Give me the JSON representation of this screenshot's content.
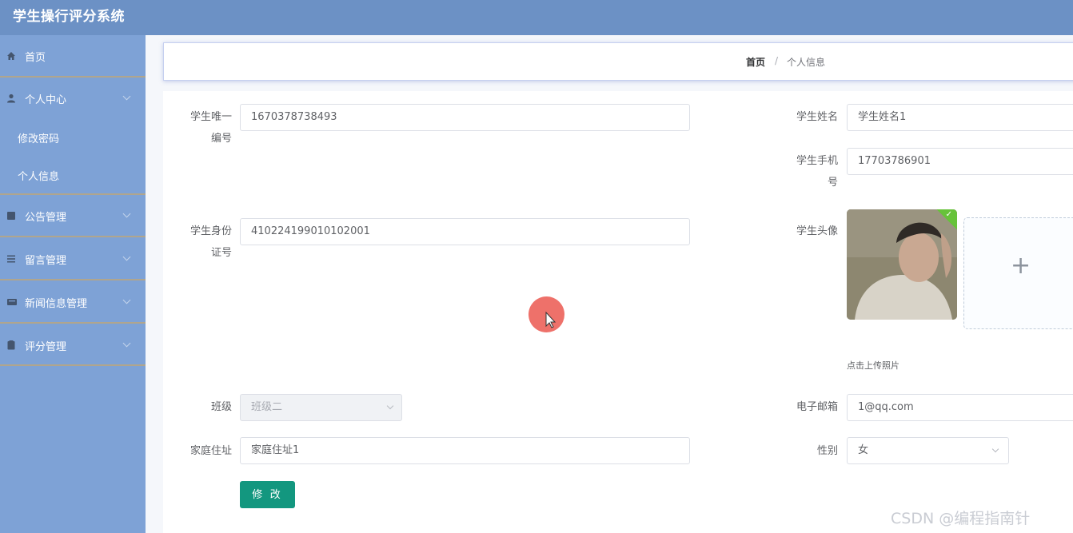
{
  "app": {
    "title": "学生操行评分系统"
  },
  "sidebar": {
    "items": [
      {
        "label": "首页",
        "icon": "home-icon"
      },
      {
        "label": "个人中心",
        "icon": "user-icon"
      },
      {
        "label": "修改密码"
      },
      {
        "label": "个人信息"
      },
      {
        "label": "公告管理",
        "icon": "notice-icon"
      },
      {
        "label": "留言管理",
        "icon": "list-icon"
      },
      {
        "label": "新闻信息管理",
        "icon": "news-icon"
      },
      {
        "label": "评分管理",
        "icon": "score-icon"
      }
    ]
  },
  "breadcrumb": {
    "home": "首页",
    "separator": "/",
    "current": "个人信息"
  },
  "form": {
    "student_id": {
      "label_line1": "学生唯一",
      "label_line2": "编号",
      "value": "1670378738493"
    },
    "student_name": {
      "label": "学生姓名",
      "value": "学生姓名1"
    },
    "student_phone": {
      "label_line1": "学生手机",
      "label_line2": "号",
      "value": "17703786901"
    },
    "id_card": {
      "label_line1": "学生身份",
      "label_line2": "证号",
      "value": "410224199010102001"
    },
    "avatar": {
      "label": "学生头像",
      "upload_tip": "点击上传照片",
      "plus": "+"
    },
    "class": {
      "label": "班级",
      "value": "班级二"
    },
    "email": {
      "label": "电子邮箱",
      "value": "1@qq.com"
    },
    "address": {
      "label": "家庭住址",
      "value": "家庭住址1"
    },
    "gender": {
      "label": "性别",
      "value": "女"
    },
    "submit_label": "修 改"
  },
  "watermark": "CSDN @编程指南针",
  "colors": {
    "header": "#6c91c5",
    "sidebar": "#7ea2d6",
    "primary_button": "#13977f",
    "menu_divider": "#b0a58d"
  }
}
